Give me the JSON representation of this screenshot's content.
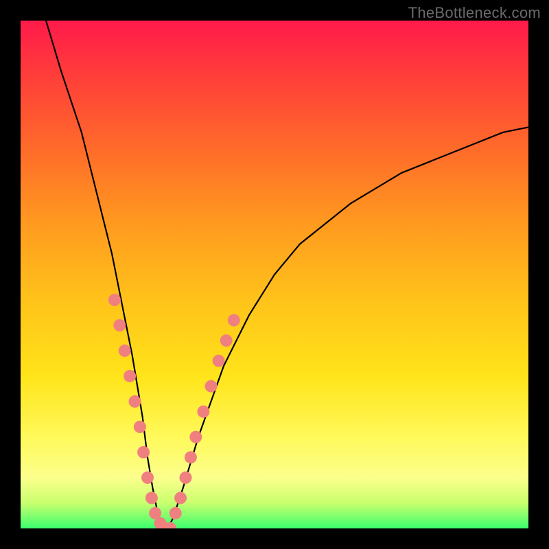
{
  "watermark": "TheBottleneck.com",
  "colors": {
    "frame_bg": "#000000",
    "gradient_top": "#ff1a4a",
    "gradient_bottom": "#3bff6e",
    "curve": "#000000",
    "dots": "#f08080"
  },
  "chart_data": {
    "type": "line",
    "title": "",
    "xlabel": "",
    "ylabel": "",
    "xlim": [
      0,
      100
    ],
    "ylim": [
      0,
      100
    ],
    "series": [
      {
        "name": "curve",
        "x": [
          5,
          8,
          12,
          16,
          18,
          20,
          22,
          24,
          25,
          26,
          27,
          28,
          29,
          30,
          32,
          35,
          40,
          45,
          50,
          55,
          60,
          65,
          70,
          75,
          80,
          85,
          90,
          95,
          100
        ],
        "y": [
          100,
          90,
          78,
          62,
          54,
          44,
          34,
          22,
          14,
          8,
          3,
          0,
          0,
          2,
          8,
          18,
          32,
          42,
          50,
          56,
          60,
          64,
          67,
          70,
          72,
          74,
          76,
          78,
          79
        ]
      }
    ],
    "markers": {
      "name": "dots",
      "points": [
        {
          "x": 18.5,
          "y": 45
        },
        {
          "x": 19.5,
          "y": 40
        },
        {
          "x": 20.5,
          "y": 35
        },
        {
          "x": 21.5,
          "y": 30
        },
        {
          "x": 22.5,
          "y": 25
        },
        {
          "x": 23.5,
          "y": 20
        },
        {
          "x": 24.2,
          "y": 15
        },
        {
          "x": 25.0,
          "y": 10
        },
        {
          "x": 25.8,
          "y": 6
        },
        {
          "x": 26.5,
          "y": 3
        },
        {
          "x": 27.5,
          "y": 1
        },
        {
          "x": 28.5,
          "y": 0
        },
        {
          "x": 29.5,
          "y": 0
        },
        {
          "x": 30.5,
          "y": 3
        },
        {
          "x": 31.5,
          "y": 6
        },
        {
          "x": 32.5,
          "y": 10
        },
        {
          "x": 33.5,
          "y": 14
        },
        {
          "x": 34.5,
          "y": 18
        },
        {
          "x": 36.0,
          "y": 23
        },
        {
          "x": 37.5,
          "y": 28
        },
        {
          "x": 39.0,
          "y": 33
        },
        {
          "x": 40.5,
          "y": 37
        },
        {
          "x": 42.0,
          "y": 41
        }
      ]
    }
  }
}
